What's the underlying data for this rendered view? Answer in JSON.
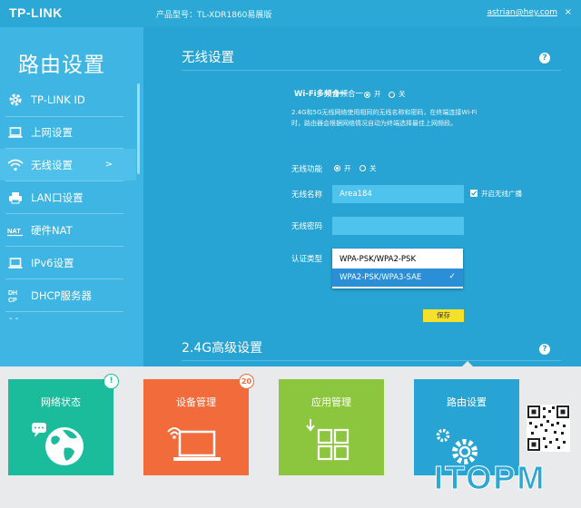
{
  "header": {
    "logo": "TP-LINK",
    "product": "产品型号：TL-XDR1860易展版",
    "account": "astrian@hey.com",
    "close": "×"
  },
  "sidebar": {
    "title": "路由设置",
    "items": [
      {
        "label": "TP-LINK ID",
        "icon": "gear-icon"
      },
      {
        "label": "上网设置",
        "icon": "laptop-icon"
      },
      {
        "label": "无线设置",
        "icon": "wifi-icon",
        "arrow": ">"
      },
      {
        "label": "LAN口设置",
        "icon": "printer-icon"
      },
      {
        "label": "硬件NAT",
        "icon": "nat-icon",
        "icon_text": "NAT"
      },
      {
        "label": "IPv6设置",
        "icon": "laptop-icon"
      },
      {
        "label": "DHCP服务器",
        "icon": "dhcp-icon",
        "icon_text": "DHCP"
      }
    ]
  },
  "wireless": {
    "title": "无线设置",
    "help": "?",
    "multiband_label": "Wi-Fi多频合一",
    "on": "开",
    "off": "关",
    "description": "2.4G和5G无线网络使用相同的无线名称和密码，在终端连接Wi-Fi时，路由器会根据网络情况自动为终端选择最佳上网频段。",
    "func_label": "无线功能",
    "ssid_label": "无线名称",
    "ssid_value": "Area184",
    "broadcast_label": "开启无线广播",
    "password_label": "无线密码",
    "password_value": "",
    "auth_label": "认证类型",
    "auth_options": [
      "WPA-PSK/WPA2-PSK",
      "WPA2-PSK/WPA3-SAE"
    ],
    "auth_selected": "WPA2-PSK/WPA3-SAE",
    "save": "保存"
  },
  "advanced": {
    "title": "2.4G高级设置",
    "help": "?"
  },
  "tiles": [
    {
      "label": "网络状态",
      "color": "#1abc9c",
      "badge": "!",
      "badge_color": "#1abc9c",
      "icon": "globe-icon"
    },
    {
      "label": "设备管理",
      "color": "#f26b3a",
      "badge": "20",
      "badge_color": "#f26b3a",
      "icon": "laptop-wifi-icon"
    },
    {
      "label": "应用管理",
      "color": "#8cc63f",
      "icon": "apps-icon"
    },
    {
      "label": "路由设置",
      "color": "#27a4d3",
      "icon": "gears-icon"
    }
  ],
  "watermark": "ITOPM",
  "colors": {
    "accent": "#27a4d3",
    "sidebar": "#3eb5e3",
    "save": "#f5e02b"
  }
}
